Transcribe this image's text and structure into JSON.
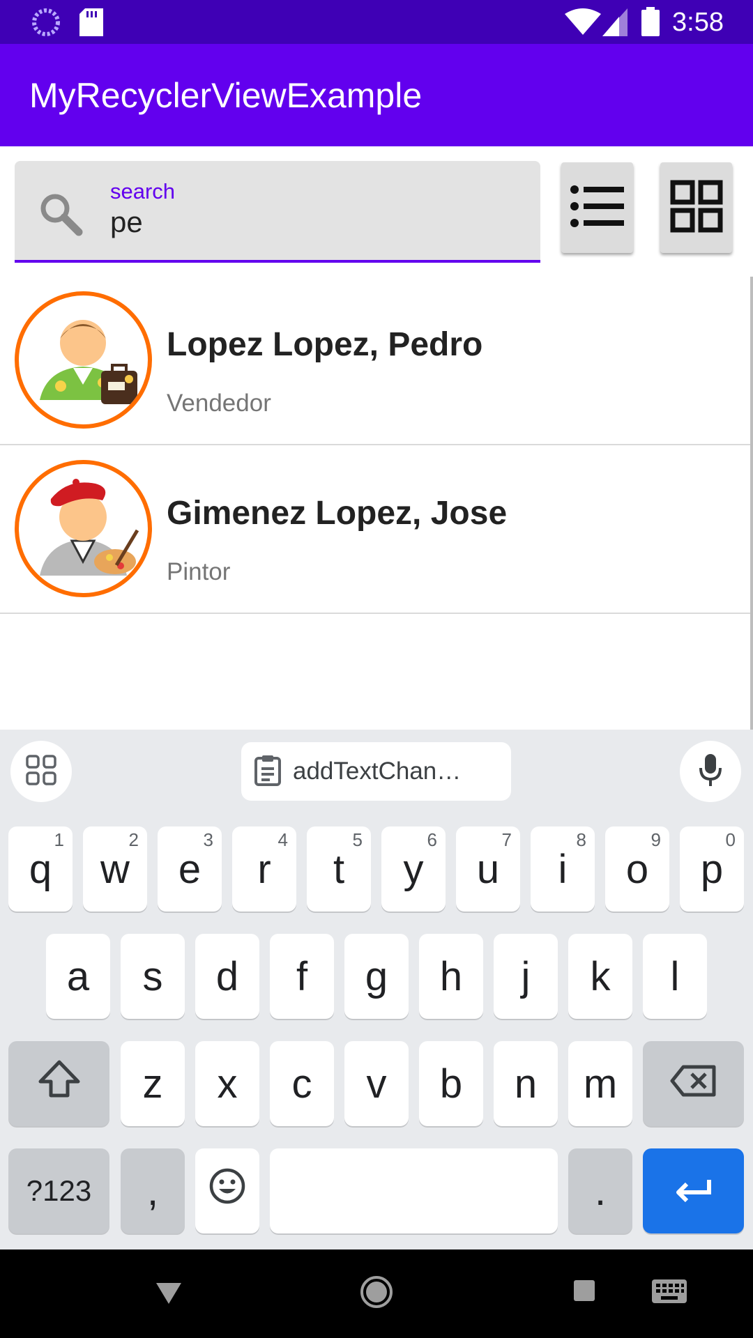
{
  "status_bar": {
    "time": "3:58",
    "icons": [
      "loading-icon",
      "sd-card-icon",
      "wifi-icon",
      "signal-icon",
      "battery-icon"
    ]
  },
  "app_bar": {
    "title": "MyRecyclerViewExample"
  },
  "search": {
    "label": "search",
    "value": "pe",
    "icon": "search-icon"
  },
  "view_toggle": {
    "list_icon": "list-view-icon",
    "grid_icon": "grid-view-icon"
  },
  "list": {
    "items": [
      {
        "name": "Lopez Lopez, Pedro",
        "role": "Vendedor",
        "avatar": "salesman-avatar"
      },
      {
        "name": "Gimenez Lopez, Jose",
        "role": "Pintor",
        "avatar": "painter-avatar"
      }
    ]
  },
  "keyboard": {
    "suggestion": "addTextChan…",
    "row1": [
      {
        "key": "q",
        "hint": "1"
      },
      {
        "key": "w",
        "hint": "2"
      },
      {
        "key": "e",
        "hint": "3"
      },
      {
        "key": "r",
        "hint": "4"
      },
      {
        "key": "t",
        "hint": "5"
      },
      {
        "key": "y",
        "hint": "6"
      },
      {
        "key": "u",
        "hint": "7"
      },
      {
        "key": "i",
        "hint": "8"
      },
      {
        "key": "o",
        "hint": "9"
      },
      {
        "key": "p",
        "hint": "0"
      }
    ],
    "row2": [
      "a",
      "s",
      "d",
      "f",
      "g",
      "h",
      "j",
      "k",
      "l"
    ],
    "row3": [
      "z",
      "x",
      "c",
      "v",
      "b",
      "n",
      "m"
    ],
    "symbols_label": "?123",
    "comma": ",",
    "period": "."
  },
  "colors": {
    "status_bar": "#3f00b5",
    "app_bar": "#6200ee",
    "accent": "#6200ee",
    "avatar_ring": "#ff6d00",
    "enter_key": "#1a73e8"
  }
}
